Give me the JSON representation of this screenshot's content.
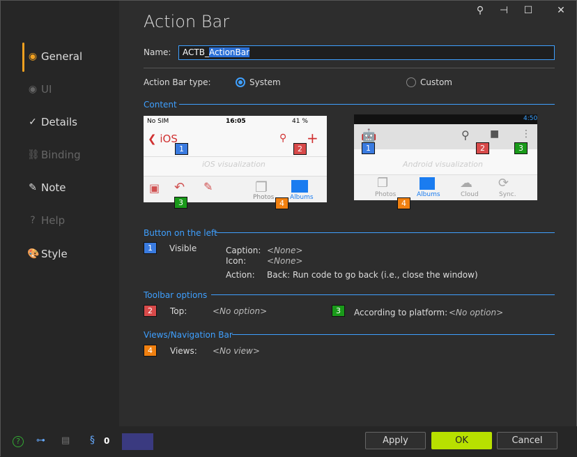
{
  "window": {
    "title": "Action Bar",
    "controls": [
      "search-icon",
      "pin-icon",
      "maximize-icon",
      "close-icon"
    ]
  },
  "sidebar": {
    "items": [
      {
        "label": "General",
        "icon": "circle-icon",
        "enabled": true,
        "selected": true
      },
      {
        "label": "UI",
        "icon": "eye-icon",
        "enabled": false
      },
      {
        "label": "Details",
        "icon": "check-circle-icon",
        "enabled": true
      },
      {
        "label": "Binding",
        "icon": "link-icon",
        "enabled": false
      },
      {
        "label": "Note",
        "icon": "pencil-icon",
        "enabled": true
      },
      {
        "label": "Help",
        "icon": "help-icon",
        "enabled": false
      },
      {
        "label": "Style",
        "icon": "palette-icon",
        "enabled": true
      }
    ]
  },
  "form": {
    "name_label": "Name:",
    "name_prefix": "ACTB_",
    "name_selected": "ActionBar",
    "type_label": "Action Bar type:",
    "type_options": [
      "System",
      "Custom"
    ],
    "type_selected": "System"
  },
  "content": {
    "title": "Content",
    "ios": {
      "carrier": "No SIM",
      "time": "16:05",
      "battery": "41 %",
      "back": "iOS",
      "caption": "iOS visualization",
      "tabs": [
        "Photos",
        "Albums"
      ]
    },
    "android": {
      "time": "4:50",
      "caption": "Android visualization",
      "tabs": [
        "Photos",
        "Albums",
        "Cloud",
        "Sync."
      ]
    }
  },
  "left_button": {
    "title": "Button on the left",
    "badge": "1",
    "visible": "Visible",
    "caption_label": "Caption:",
    "caption_value": "<None>",
    "icon_label": "Icon:",
    "icon_value": "<None>",
    "action_label": "Action:",
    "action_value": "Back: Run code to go back (i.e., close the window)"
  },
  "toolbar": {
    "title": "Toolbar options",
    "top_badge": "2",
    "top_label": "Top:",
    "top_value": "<No option>",
    "platform_badge": "3",
    "platform_label": "According to platform:",
    "platform_value": "<No option>"
  },
  "views": {
    "title": "Views/Navigation Bar",
    "badge": "4",
    "label": "Views:",
    "value": "<No view>"
  },
  "footer": {
    "counter": "0",
    "apply": "Apply",
    "ok": "OK",
    "cancel": "Cancel"
  },
  "colors": {
    "accent": "#3fa0ff",
    "ok": "#b8e000",
    "selected": "#f0a020",
    "badge1": "#3a7be0",
    "badge2": "#d84a4a",
    "badge3": "#1a9a1a",
    "badge4": "#f08010"
  }
}
